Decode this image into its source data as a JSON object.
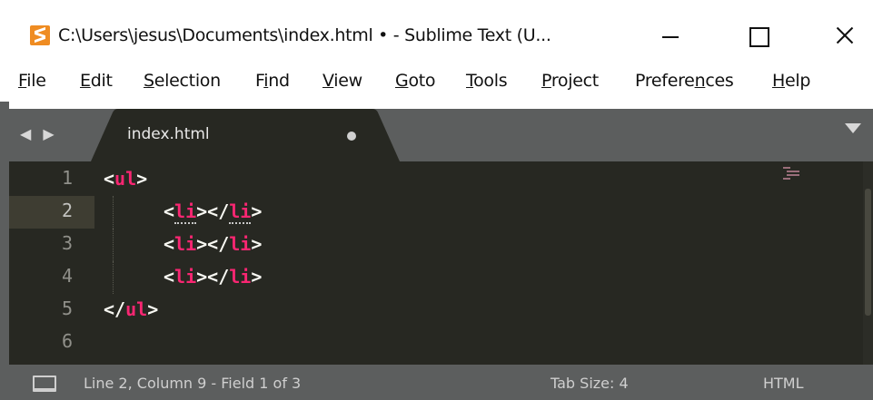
{
  "window": {
    "title": "C:\\Users\\jesus\\Documents\\index.html • - Sublime Text (U...",
    "logo_icon": "sublime-logo-icon"
  },
  "menu": {
    "items": [
      {
        "prefix": "",
        "accel": "F",
        "rest": "ile"
      },
      {
        "prefix": "",
        "accel": "E",
        "rest": "dit"
      },
      {
        "prefix": "",
        "accel": "S",
        "rest": "election"
      },
      {
        "prefix": "F",
        "accel": "i",
        "rest": "nd"
      },
      {
        "prefix": "",
        "accel": "V",
        "rest": "iew"
      },
      {
        "prefix": "",
        "accel": "G",
        "rest": "oto"
      },
      {
        "prefix": "",
        "accel": "T",
        "rest": "ools"
      },
      {
        "prefix": "",
        "accel": "P",
        "rest": "roject"
      },
      {
        "prefix": "Prefere",
        "accel": "n",
        "rest": "ces"
      },
      {
        "prefix": "",
        "accel": "H",
        "rest": "elp"
      }
    ]
  },
  "tabs": {
    "nav_arrows": "◀ ▶",
    "active": {
      "label": "index.html",
      "dirty": true
    }
  },
  "editor": {
    "lines": [
      {
        "num": "1",
        "open": "<",
        "tag": "ul",
        "close": ">"
      },
      {
        "num": "2",
        "indent": "    ",
        "open": "<",
        "tag": "li",
        "mid": "></",
        "tag2": "li",
        "close": ">"
      },
      {
        "num": "3",
        "indent": "    ",
        "open": "<",
        "tag": "li",
        "mid": "></",
        "tag2": "li",
        "close": ">"
      },
      {
        "num": "4",
        "indent": "    ",
        "open": "<",
        "tag": "li",
        "mid": "></",
        "tag2": "li",
        "close": ">"
      },
      {
        "num": "5",
        "open": "</",
        "tag": "ul",
        "close": ">"
      },
      {
        "num": "6"
      }
    ],
    "current_line": 2
  },
  "status": {
    "position": "Line 2, Column 9 - Field 1 of 3",
    "tab_size": "Tab Size: 4",
    "syntax": "HTML"
  },
  "colors": {
    "editor_bg": "#272822",
    "tag": "#f92672",
    "chrome": "#5c5e5e"
  }
}
